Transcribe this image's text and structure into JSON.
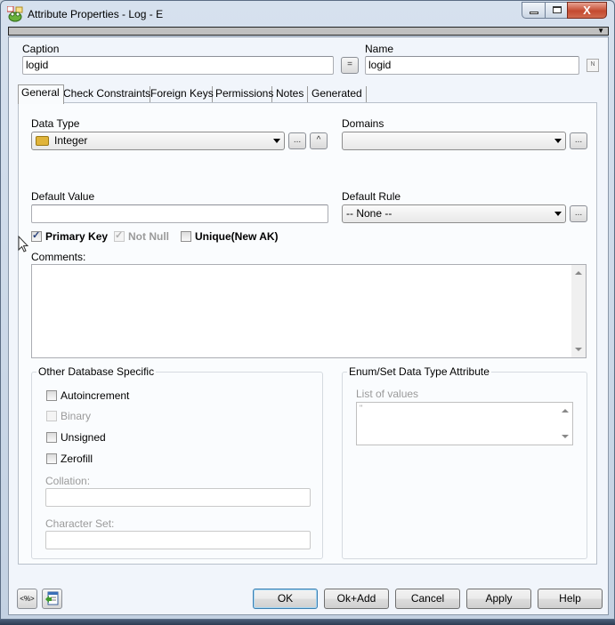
{
  "window": {
    "title": "Attribute Properties - Log - E",
    "controls": {
      "minimize": "minimize",
      "maximize": "maximize",
      "close": "X"
    }
  },
  "header": {
    "caption_label": "Caption",
    "caption_value": "logid",
    "equal_button": "=",
    "name_label": "Name",
    "name_value": "logid",
    "name_icon": "N"
  },
  "tabs": [
    {
      "label": "General",
      "active": true
    },
    {
      "label": "Check Constraints"
    },
    {
      "label": "Foreign Keys"
    },
    {
      "label": "Permissions"
    },
    {
      "label": "Notes"
    },
    {
      "label": "Generated"
    }
  ],
  "general": {
    "data_type_label": "Data Type",
    "data_type_value": "Integer",
    "data_type_browse": "...",
    "data_type_up": "^",
    "domains_label": "Domains",
    "domains_value": "",
    "domains_browse": "...",
    "default_value_label": "Default Value",
    "default_value": "",
    "default_rule_label": "Default Rule",
    "default_rule_value": "-- None --",
    "default_rule_browse": "...",
    "checks": {
      "primary_key": {
        "label": "Primary Key",
        "checked": true
      },
      "not_null": {
        "label": "Not Null",
        "checked": true,
        "disabled": true
      },
      "unique": {
        "label": "Unique(New AK)",
        "checked": false
      }
    },
    "comments_label": "Comments:",
    "comments_value": ""
  },
  "other_db": {
    "title": "Other Database Specific",
    "autoincrement": {
      "label": "Autoincrement",
      "checked": false
    },
    "binary": {
      "label": "Binary",
      "checked": false,
      "disabled": true
    },
    "unsigned": {
      "label": "Unsigned",
      "checked": false
    },
    "zerofill": {
      "label": "Zerofill",
      "checked": false
    },
    "collation_label": "Collation:",
    "collation_value": "",
    "charset_label": "Character Set:",
    "charset_value": ""
  },
  "enum_set": {
    "title": "Enum/Set Data Type Attribute",
    "list_label": "List of values",
    "list_value": "\""
  },
  "footer": {
    "macro_button": "<%>",
    "ok": "OK",
    "ok_add": "Ok+Add",
    "cancel": "Cancel",
    "apply": "Apply",
    "help": "Help"
  }
}
